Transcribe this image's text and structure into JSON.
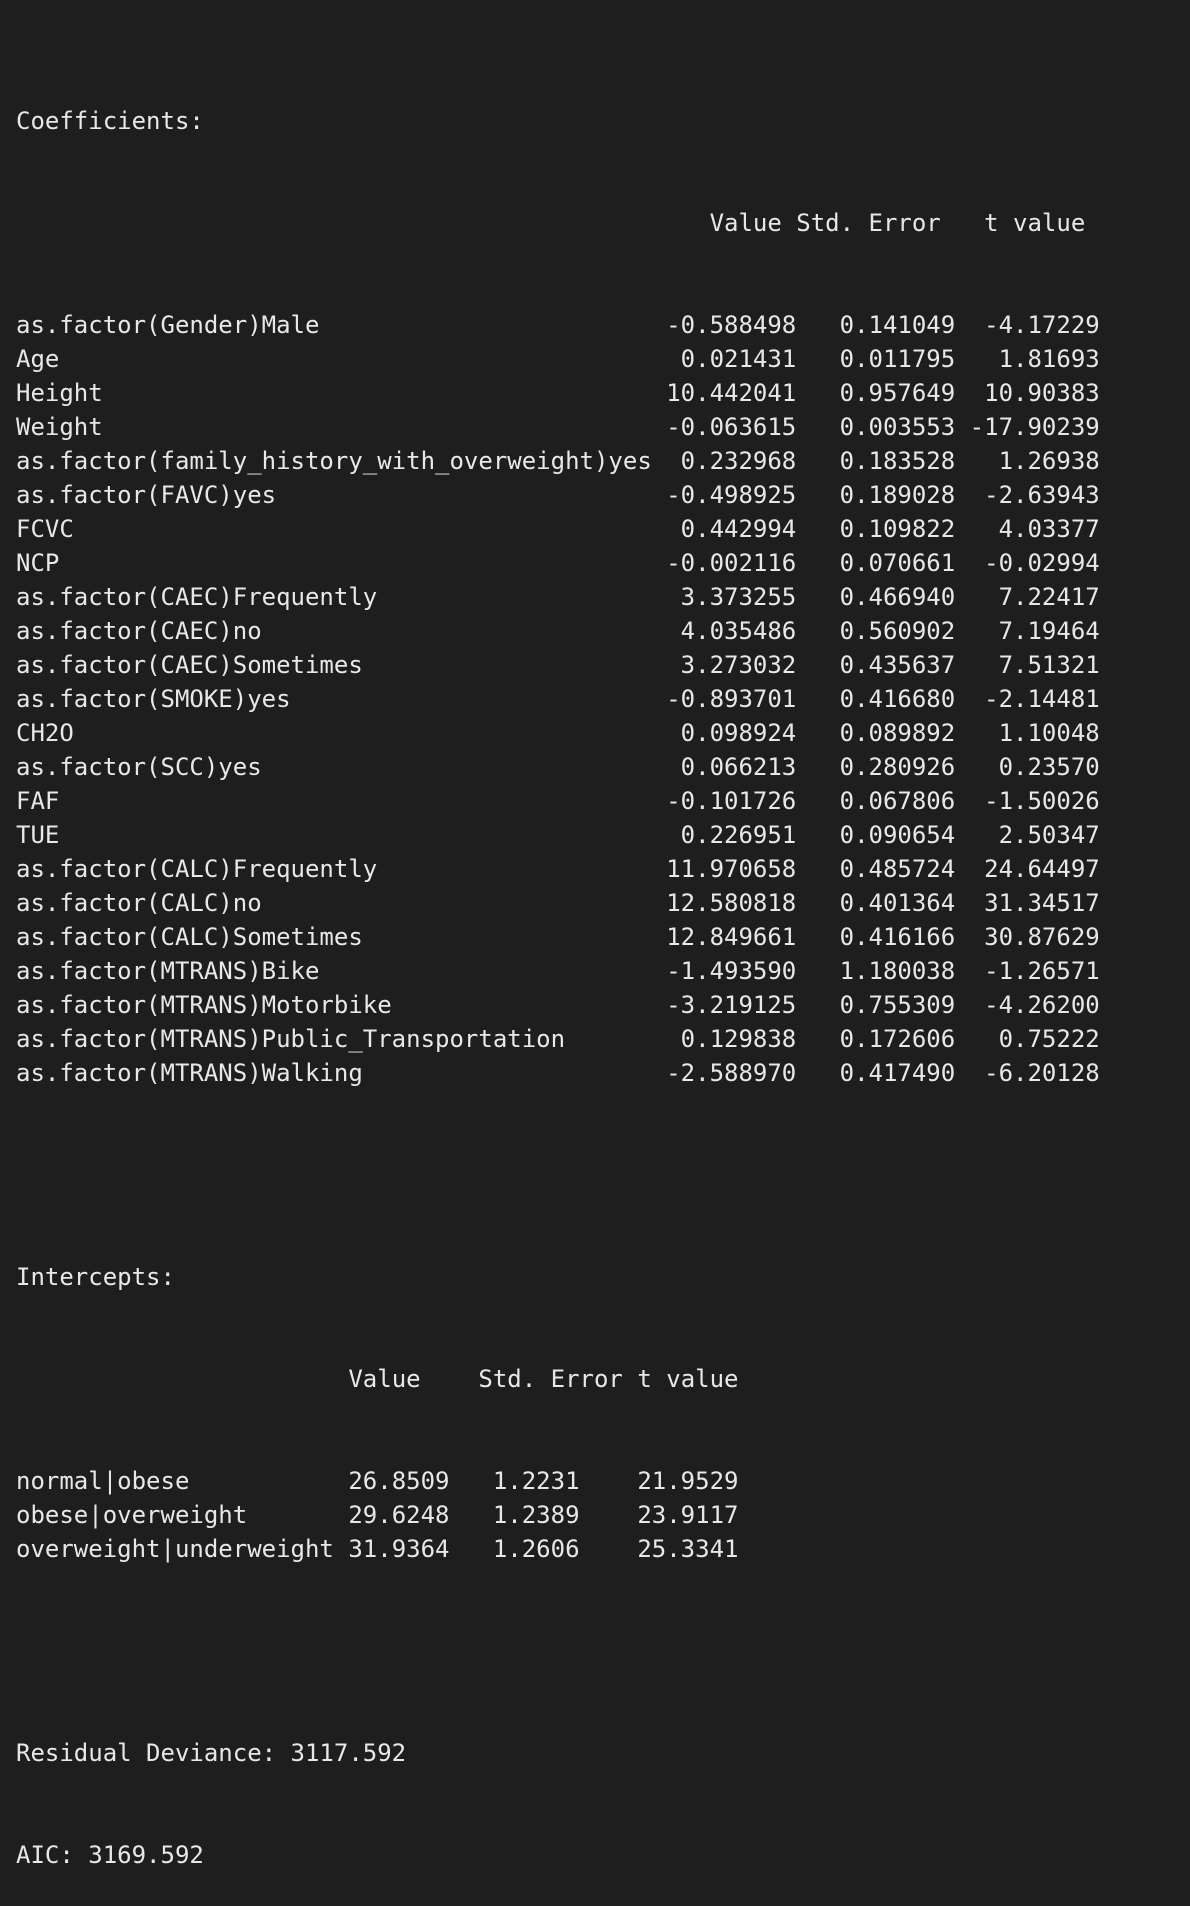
{
  "coefficients": {
    "heading": "Coefficients:",
    "columns": [
      "Value",
      "Std. Error",
      "t value"
    ],
    "rows": [
      {
        "name": "as.factor(Gender)Male",
        "value": "-0.588498",
        "se": "0.141049",
        "t": "-4.17229"
      },
      {
        "name": "Age",
        "value": "0.021431",
        "se": "0.011795",
        "t": "1.81693"
      },
      {
        "name": "Height",
        "value": "10.442041",
        "se": "0.957649",
        "t": "10.90383"
      },
      {
        "name": "Weight",
        "value": "-0.063615",
        "se": "0.003553",
        "t": "-17.90239"
      },
      {
        "name": "as.factor(family_history_with_overweight)yes",
        "value": "0.232968",
        "se": "0.183528",
        "t": "1.26938"
      },
      {
        "name": "as.factor(FAVC)yes",
        "value": "-0.498925",
        "se": "0.189028",
        "t": "-2.63943"
      },
      {
        "name": "FCVC",
        "value": "0.442994",
        "se": "0.109822",
        "t": "4.03377"
      },
      {
        "name": "NCP",
        "value": "-0.002116",
        "se": "0.070661",
        "t": "-0.02994"
      },
      {
        "name": "as.factor(CAEC)Frequently",
        "value": "3.373255",
        "se": "0.466940",
        "t": "7.22417"
      },
      {
        "name": "as.factor(CAEC)no",
        "value": "4.035486",
        "se": "0.560902",
        "t": "7.19464"
      },
      {
        "name": "as.factor(CAEC)Sometimes",
        "value": "3.273032",
        "se": "0.435637",
        "t": "7.51321"
      },
      {
        "name": "as.factor(SMOKE)yes",
        "value": "-0.893701",
        "se": "0.416680",
        "t": "-2.14481"
      },
      {
        "name": "CH2O",
        "value": "0.098924",
        "se": "0.089892",
        "t": "1.10048"
      },
      {
        "name": "as.factor(SCC)yes",
        "value": "0.066213",
        "se": "0.280926",
        "t": "0.23570"
      },
      {
        "name": "FAF",
        "value": "-0.101726",
        "se": "0.067806",
        "t": "-1.50026"
      },
      {
        "name": "TUE",
        "value": "0.226951",
        "se": "0.090654",
        "t": "2.50347"
      },
      {
        "name": "as.factor(CALC)Frequently",
        "value": "11.970658",
        "se": "0.485724",
        "t": "24.64497"
      },
      {
        "name": "as.factor(CALC)no",
        "value": "12.580818",
        "se": "0.401364",
        "t": "31.34517"
      },
      {
        "name": "as.factor(CALC)Sometimes",
        "value": "12.849661",
        "se": "0.416166",
        "t": "30.87629"
      },
      {
        "name": "as.factor(MTRANS)Bike",
        "value": "-1.493590",
        "se": "1.180038",
        "t": "-1.26571"
      },
      {
        "name": "as.factor(MTRANS)Motorbike",
        "value": "-3.219125",
        "se": "0.755309",
        "t": "-4.26200"
      },
      {
        "name": "as.factor(MTRANS)Public_Transportation",
        "value": "0.129838",
        "se": "0.172606",
        "t": "0.75222"
      },
      {
        "name": "as.factor(MTRANS)Walking",
        "value": "-2.588970",
        "se": "0.417490",
        "t": "-6.20128"
      }
    ]
  },
  "intercepts": {
    "heading": "Intercepts:",
    "columns": [
      "Value",
      "Std. Error",
      "t value"
    ],
    "rows": [
      {
        "name": "normal|obese",
        "value": "26.8509",
        "se": "1.2231",
        "t": "21.9529"
      },
      {
        "name": "obese|overweight",
        "value": "29.6248",
        "se": "1.2389",
        "t": "23.9117"
      },
      {
        "name": "overweight|underweight",
        "value": "31.9364",
        "se": "1.2606",
        "t": "25.3341"
      }
    ]
  },
  "summary": {
    "residual_deviance": "Residual Deviance: 3117.592",
    "aic": "AIC: 3169.592"
  }
}
